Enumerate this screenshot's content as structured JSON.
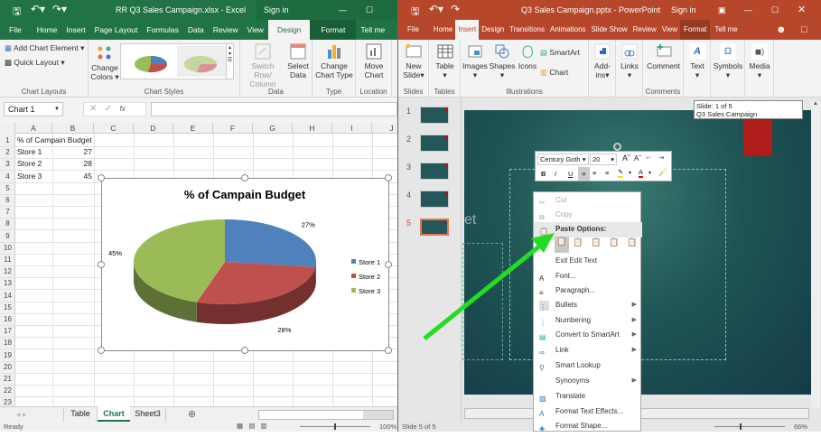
{
  "excel": {
    "title": "RR Q3 Sales Campaign.xlsx  -  Excel",
    "sign_in": "Sign in",
    "tabs": [
      "File",
      "Home",
      "Insert",
      "Page Layout",
      "Formulas",
      "Data",
      "Review",
      "View",
      "Design",
      "Format",
      "Tell me"
    ],
    "active_tab": "Design",
    "ribbon": {
      "add_chart_element": "Add Chart Element",
      "quick_layout": "Quick Layout",
      "change_colors_1": "Change",
      "change_colors_2": "Colors",
      "switch_1": "Switch Row/",
      "switch_2": "Column",
      "select_1": "Select",
      "select_2": "Data",
      "change_type_1": "Change",
      "change_type_2": "Chart Type",
      "move_1": "Move",
      "move_2": "Chart",
      "groups": {
        "layouts": "Chart Layouts",
        "styles": "Chart Styles",
        "data": "Data",
        "type": "Type",
        "location": "Location"
      }
    },
    "name_box": "Chart 1",
    "fx": "fx",
    "columns": [
      "A",
      "B",
      "C",
      "D",
      "E",
      "F",
      "G",
      "H",
      "I",
      "J"
    ],
    "rows": [
      "1",
      "2",
      "3",
      "4",
      "5",
      "6",
      "7",
      "8",
      "9",
      "10",
      "11",
      "12",
      "13",
      "14",
      "15",
      "16",
      "17",
      "18",
      "19",
      "20",
      "21",
      "22",
      "23"
    ],
    "cells": {
      "a1": "% of Campain Budget",
      "a2": "Store 1",
      "b2": "27",
      "a3": "Store 2",
      "b3": "28",
      "a4": "Store 3",
      "b4": "45"
    },
    "sheet_tabs": [
      "Table",
      "Chart",
      "Sheet3"
    ],
    "active_sheet": "Chart",
    "status": "Ready",
    "zoom": "100%"
  },
  "chart_data": {
    "type": "pie",
    "title": "% of Campain Budget",
    "categories": [
      "Store 1",
      "Store 2",
      "Store 3"
    ],
    "values": [
      27,
      28,
      45
    ],
    "labels": [
      "27%",
      "28%",
      "45%"
    ],
    "colors": [
      "#4f81bd",
      "#c0504d",
      "#9bbb59"
    ],
    "legend": "right"
  },
  "ppt": {
    "title": "Q3 Sales Campaign.pptx  -  PowerPoint",
    "sign_in": "Sign in",
    "tabs": [
      "File",
      "Home",
      "Insert",
      "Design",
      "Transitions",
      "Animations",
      "Slide Show",
      "Review",
      "View",
      "Format",
      "Tell me"
    ],
    "active_tab": "Insert",
    "ribbon": {
      "new_slide_1": "New",
      "new_slide_2": "Slide",
      "table": "Table",
      "images": "Images",
      "shapes": "Shapes",
      "icons": "Icons",
      "smartart": "SmartArt",
      "chart": "Chart",
      "addins_1": "Add-",
      "addins_2": "ins",
      "links": "Links",
      "comment": "Comment",
      "text": "Text",
      "symbols": "Symbols",
      "media": "Media",
      "groups": {
        "slides": "Slides",
        "tables": "Tables",
        "illustrations": "Illustrations",
        "comments": "Comments"
      }
    },
    "slides": [
      "1",
      "2",
      "3",
      "4",
      "5"
    ],
    "active_slide": 5,
    "tooltip": {
      "line1": "Slide: 1 of 5",
      "line2": "Q3 Sales Campaign"
    },
    "slide_partial_text": "et",
    "mini_toolbar": {
      "font": "Century Goth",
      "size": "20",
      "bold": "B",
      "italic": "I",
      "underline": "U"
    },
    "context_menu": {
      "cut": "Cut",
      "copy": "Copy",
      "paste_options": "Paste Options:",
      "exit_edit": "Exit Edit Text",
      "font": "Font...",
      "paragraph": "Paragraph...",
      "bullets": "Bullets",
      "numbering": "Numbering",
      "smartart": "Convert to SmartArt",
      "link": "Link",
      "smart_lookup": "Smart Lookup",
      "synonyms": "Synonyms",
      "translate": "Translate",
      "text_effects": "Format Text Effects...",
      "format_shape": "Format Shape..."
    },
    "status": "Slide 5 of 5",
    "zoom": "66%"
  },
  "colors": {
    "excel": "#217346",
    "ppt": "#b7472a",
    "arrow": "#22dd22"
  }
}
